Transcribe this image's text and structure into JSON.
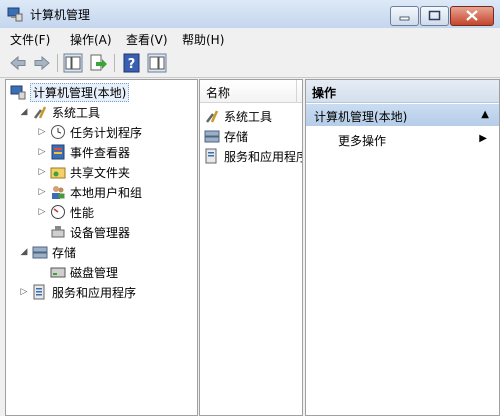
{
  "window": {
    "title": "计算机管理"
  },
  "menu": [
    "文件(F)",
    "操作(A)",
    "查看(V)",
    "帮助(H)"
  ],
  "toolbar": {
    "buttons": [
      "back-arrow-icon",
      "forward-arrow-icon",
      "show-tree-icon",
      "export-list-icon",
      "help-icon",
      "action-pane-icon"
    ]
  },
  "tree": {
    "root": "计算机管理(本地)",
    "system_tools": "系统工具",
    "task_scheduler": "任务计划程序",
    "event_viewer": "事件查看器",
    "shared_folders": "共享文件夹",
    "local_users": "本地用户和组",
    "performance": "性能",
    "device_manager": "设备管理器",
    "storage": "存储",
    "disk_management": "磁盘管理",
    "services_apps": "服务和应用程序"
  },
  "list": {
    "header": "名称",
    "items": [
      "系统工具",
      "存储",
      "服务和应用程序"
    ]
  },
  "actions": {
    "header": "操作",
    "group": "计算机管理(本地)",
    "more": "更多操作"
  }
}
